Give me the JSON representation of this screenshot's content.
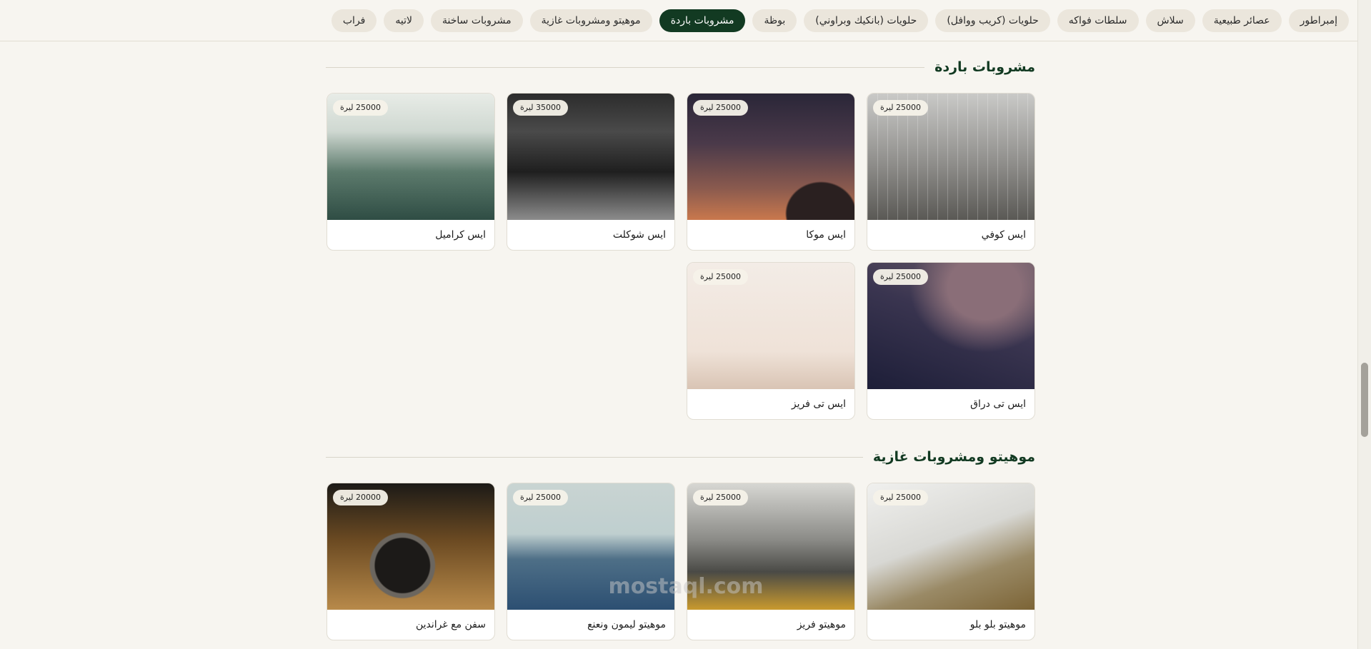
{
  "nav": {
    "categories": [
      "إمبراطور",
      "عصائر طبيعية",
      "سلاش",
      "سلطات فواكه",
      "حلويات (كريب ووافل)",
      "حلويات (بانكيك وبراوني)",
      "بوظة",
      "مشروبات باردة",
      "موهيتو ومشروبات غازية",
      "مشروبات ساخنة",
      "لاتيه",
      "فراب"
    ],
    "active_index": 7
  },
  "sections": [
    {
      "title": "مشروبات باردة",
      "items": [
        {
          "name": "ايس كوفي",
          "price": "25000 ليرة",
          "image": "bridge-cables"
        },
        {
          "name": "ايس موكا",
          "price": "25000 ليرة",
          "image": "dusk-sky"
        },
        {
          "name": "ايس شوكلت",
          "price": "35000 ليرة",
          "image": "night-city-bridge"
        },
        {
          "name": "ايس كراميل",
          "price": "25000 ليرة",
          "image": "misty-forest"
        },
        {
          "name": "ايس تى دراق",
          "price": "25000 ليرة",
          "image": "starry-sky"
        },
        {
          "name": "ايس تى فريز",
          "price": "25000 ليرة",
          "image": "palm-trees"
        }
      ]
    },
    {
      "title": "موهيتو ومشروبات غازية",
      "items": [
        {
          "name": "موهيتو بلو بلو",
          "price": "25000 ليرة",
          "image": "hills"
        },
        {
          "name": "موهيتو فريز",
          "price": "25000 ليرة",
          "image": "taxi-street"
        },
        {
          "name": "موهيتو ليمون ونعنع",
          "price": "25000 ليرة",
          "image": "sea-ships"
        },
        {
          "name": "سفن مع غراندين",
          "price": "20000 ليرة",
          "image": "vintage-camera"
        }
      ]
    }
  ],
  "watermark": "mostaql.com"
}
